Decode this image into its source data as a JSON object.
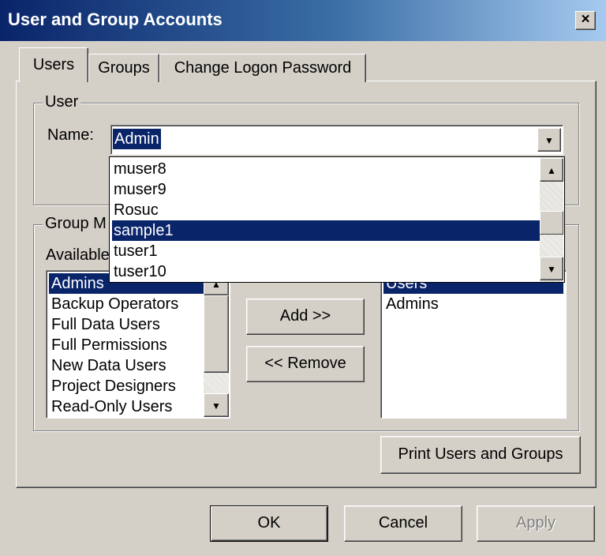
{
  "window": {
    "title": "User and Group Accounts",
    "close_glyph": "×"
  },
  "tabs": [
    {
      "label": "Users",
      "active": true
    },
    {
      "label": "Groups",
      "active": false
    },
    {
      "label": "Change Logon Password",
      "active": false
    }
  ],
  "user_group": {
    "legend": "User",
    "name_label": "Name:",
    "name_value": "Admin",
    "dropdown_items": [
      "muser8",
      "muser9",
      "Rosuc",
      "sample1",
      "tuser1",
      "tuser10"
    ],
    "dropdown_selected": "sample1"
  },
  "group_membership": {
    "legend": "Group M",
    "available_label": "Available",
    "available_groups": [
      "Admins",
      "Backup Operators",
      "Full Data Users",
      "Full Permissions",
      "New Data Users",
      "Project Designers",
      "Read-Only Users"
    ],
    "available_selected": "Admins",
    "member_of": [
      "Users",
      "Admins"
    ],
    "member_selected": "Users",
    "add_label": "Add >>",
    "remove_label": "<< Remove"
  },
  "print_label": "Print Users and Groups",
  "buttons": {
    "ok": "OK",
    "cancel": "Cancel",
    "apply": "Apply"
  },
  "colors": {
    "selection": "#0a246a",
    "title_bar": "#0a246a",
    "face": "#d4d0c8"
  }
}
